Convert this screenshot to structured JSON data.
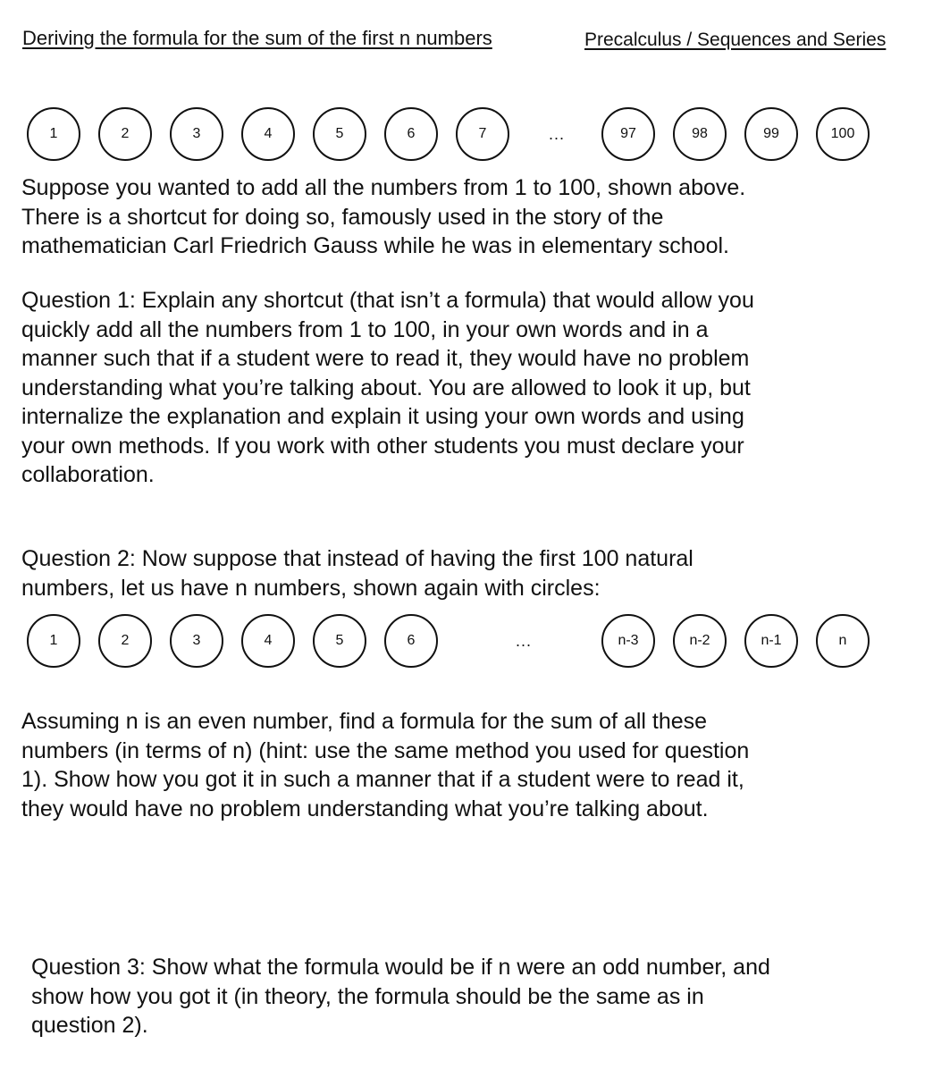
{
  "header": {
    "title": "Deriving the formula for the sum of the first n numbers",
    "course": "Precalculus / Sequences and Series"
  },
  "circles_row_1": {
    "first": [
      "1",
      "2",
      "3",
      "4",
      "5",
      "6",
      "7"
    ],
    "ellipsis": "...",
    "last": [
      "97",
      "98",
      "99",
      "100"
    ]
  },
  "intro": {
    "lines": [
      "Suppose you wanted to add all the numbers from 1 to 100, shown above.",
      "There is a shortcut for doing so, famously used in the story of the",
      "mathematician Carl Friedrich Gauss while he was in elementary school."
    ]
  },
  "question1": {
    "lines": [
      "Question 1: Explain any shortcut (that isn’t a formula) that would allow you",
      "quickly add all the numbers from 1 to 100, in your own words and in a",
      "manner such that if a student were to read it, they would have no problem",
      "understanding what you’re talking about. You are allowed to look it up, but",
      "internalize the explanation and explain it using your own words and using",
      "your own methods. If you work with other students you must declare your",
      "collaboration."
    ]
  },
  "question2": {
    "intro_lines": [
      "Question 2: Now suppose that instead of having the first 100 natural",
      "numbers, let us have n numbers, shown again with circles:"
    ],
    "body_lines": [
      "Assuming n is an even number, find a formula for the sum of all these",
      "numbers (in terms of n) (hint: use the same method you used for question",
      "1). Show how you got it in such a manner that if a student were to read it,",
      "they would have no problem understanding what you’re talking about."
    ]
  },
  "circles_row_2": {
    "first": [
      "1",
      "2",
      "3",
      "4",
      "5",
      "6"
    ],
    "ellipsis": "...",
    "last": [
      "n-3",
      "n-2",
      "n-1",
      "n"
    ]
  },
  "question3": {
    "lines": [
      "Question 3: Show what the formula would be if n were an odd number, and",
      "show how you got it (in theory, the formula should be the same as in",
      "question 2)."
    ]
  }
}
